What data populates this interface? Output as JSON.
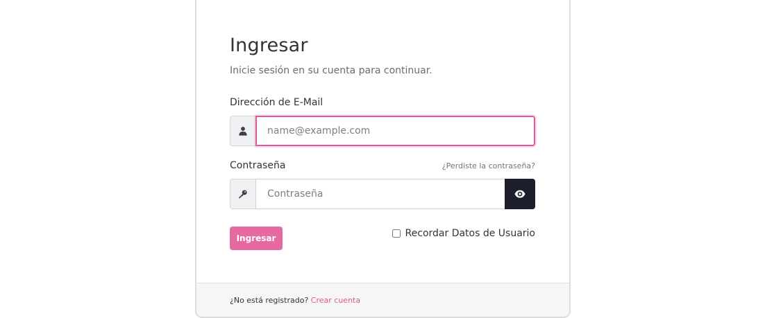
{
  "login": {
    "title": "Ingresar",
    "subtitle": "Inicie sesión en su cuenta para continuar.",
    "email": {
      "label": "Dirección de E-Mail",
      "value": "",
      "placeholder": "name@example.com",
      "icon": "user-icon"
    },
    "password": {
      "label": "Contraseña",
      "value": "",
      "placeholder": "Contraseña",
      "icon": "key-icon",
      "toggle_icon": "eye-icon"
    },
    "forgot_password": "¿Perdiste la contraseña?",
    "submit_label": "Ingresar",
    "remember_me": {
      "label": "Recordar Datos de Usuario",
      "checked": false
    }
  },
  "footer": {
    "prompt": "¿No está registrado?",
    "register_link": "Crear cuenta"
  },
  "colors": {
    "accent": "#e66aa2",
    "focus_border": "#e05a9a",
    "toggle_button": "#1c1f2b",
    "link": "#e0559a"
  }
}
